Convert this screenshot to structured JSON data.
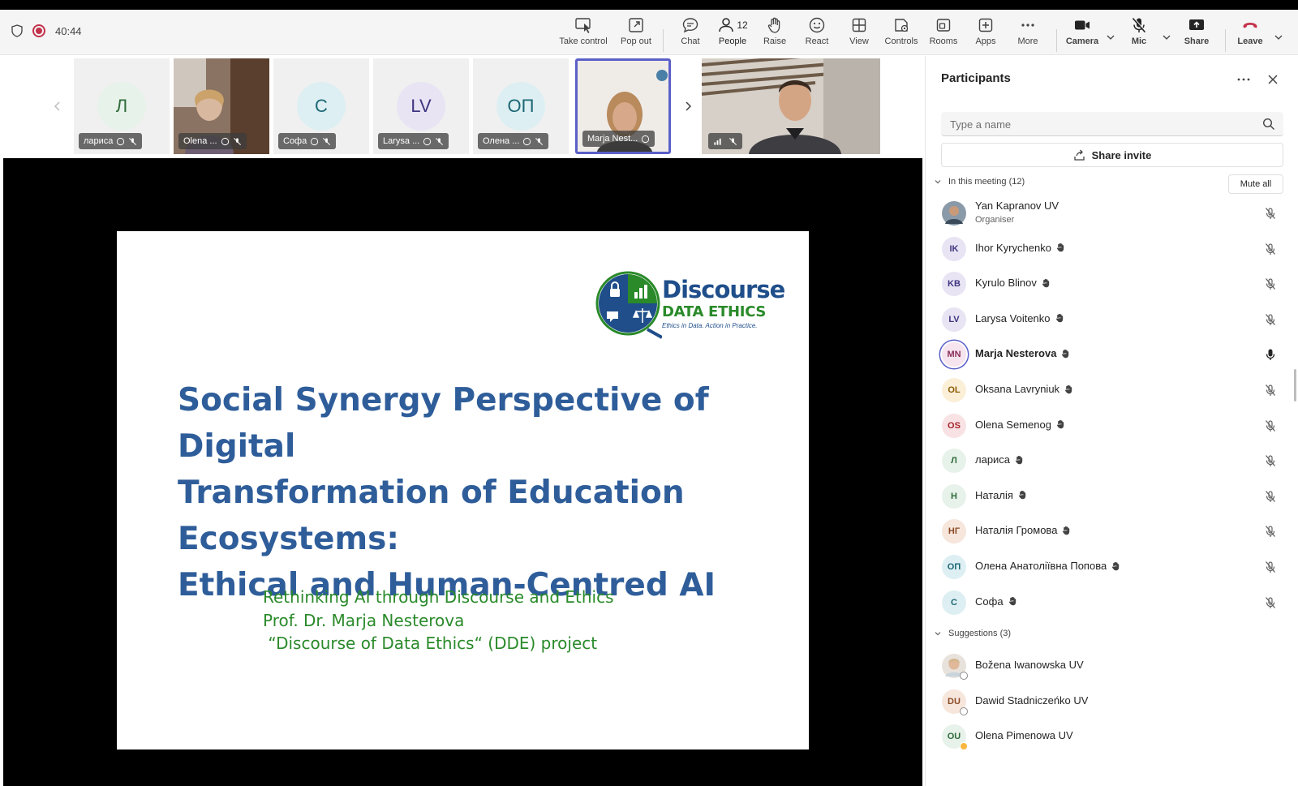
{
  "meeting": {
    "timer": "40:44"
  },
  "toolbar": {
    "take_control": "Take control",
    "pop_out": "Pop out",
    "chat": "Chat",
    "people": "People",
    "people_count": "12",
    "raise": "Raise",
    "react": "React",
    "view": "View",
    "controls": "Controls",
    "rooms": "Rooms",
    "apps": "Apps",
    "more": "More",
    "camera": "Camera",
    "mic": "Mic",
    "share": "Share",
    "leave": "Leave"
  },
  "filmstrip": [
    {
      "initials": "Л",
      "name": "лариса",
      "bg": "#e7f2ea",
      "fg": "#2e6b3a"
    },
    {
      "name": "Olena ...",
      "photo": true
    },
    {
      "initials": "С",
      "name": "Софа",
      "bg": "#ddeff2",
      "fg": "#1c6775"
    },
    {
      "initials": "LV",
      "name": "Larysa ...",
      "bg": "#e8e4f4",
      "fg": "#3e3580"
    },
    {
      "initials": "ОП",
      "name": "Олена ...",
      "bg": "#ddeff2",
      "fg": "#1c6775"
    },
    {
      "name": "Marja Nest...",
      "photo": true,
      "active": true
    },
    {
      "name": "",
      "photo": true,
      "wide": true
    }
  ],
  "slide": {
    "logo_brand": "Discourse",
    "logo_sub": "DATA ETHICS",
    "logo_tagline": "Ethics in Data. Action in Practice.",
    "title_lines": [
      "Social Synergy Perspective of Digital",
      "Transformation of Education",
      "Ecosystems:",
      "Ethical and Human-Centred AI"
    ],
    "subtitle_lines": [
      "Rethinking AI through Discourse and Ethics",
      "Prof. Dr. Marja Nesterova",
      " “Discourse of Data Ethics“ (DDE) project"
    ],
    "colors": {
      "title": "#2e5d9a",
      "subtitle": "#2a8a2a"
    }
  },
  "panel": {
    "title": "Participants",
    "search_placeholder": "Type a name",
    "share_invite": "Share invite",
    "in_meeting_label": "In this meeting (12)",
    "mute_all": "Mute all",
    "suggestions_label": "Suggestions (3)",
    "participants": [
      {
        "initials": "",
        "name": "Yan Kapranov UV",
        "role": "Organiser",
        "photo": true,
        "mic": "muted"
      },
      {
        "initials": "IK",
        "name": "Ihor Kyrychenko",
        "bg": "#e8e4f4",
        "fg": "#3e3580",
        "mic": "muted"
      },
      {
        "initials": "KB",
        "name": "Kyrulo Blinov",
        "bg": "#e8e4f4",
        "fg": "#3e3580",
        "mic": "muted"
      },
      {
        "initials": "LV",
        "name": "Larysa Voitenko",
        "bg": "#e8e4f4",
        "fg": "#3e3580",
        "mic": "muted"
      },
      {
        "initials": "MN",
        "name": "Marja Nesterova",
        "bg": "#f6e4ee",
        "fg": "#8a2f5c",
        "mic": "on",
        "speaking": true
      },
      {
        "initials": "OL",
        "name": "Oksana Lavryniuk",
        "bg": "#fcefd8",
        "fg": "#8a5a00",
        "mic": "muted"
      },
      {
        "initials": "OS",
        "name": "Olena Semenog",
        "bg": "#f8e2e4",
        "fg": "#a4262c",
        "mic": "muted"
      },
      {
        "initials": "Л",
        "name": "лариса",
        "bg": "#e7f2ea",
        "fg": "#2e6b3a",
        "mic": "muted"
      },
      {
        "initials": "Н",
        "name": "Наталія",
        "bg": "#e7f2ea",
        "fg": "#2e6b3a",
        "mic": "muted"
      },
      {
        "initials": "НГ",
        "name": "Наталія Громова",
        "bg": "#f6e6dc",
        "fg": "#8a4a25",
        "mic": "muted"
      },
      {
        "initials": "ОП",
        "name": "Олена Анатоліївна Попова",
        "bg": "#ddeff2",
        "fg": "#1c6775",
        "mic": "muted"
      },
      {
        "initials": "С",
        "name": "Софа",
        "bg": "#ddeff2",
        "fg": "#1c6775",
        "mic": "muted"
      }
    ],
    "suggestions": [
      {
        "initials": "",
        "name": "Božena Iwanowska UV",
        "photo": true,
        "status": "offline"
      },
      {
        "initials": "DU",
        "name": "Dawid Stadniczeńko UV",
        "bg": "#f6e6dc",
        "fg": "#8a4a25",
        "status": "offline"
      },
      {
        "initials": "OU",
        "name": "Olena Pimenowa UV",
        "bg": "#e7f2ea",
        "fg": "#2e6b3a",
        "status": "away"
      }
    ]
  }
}
